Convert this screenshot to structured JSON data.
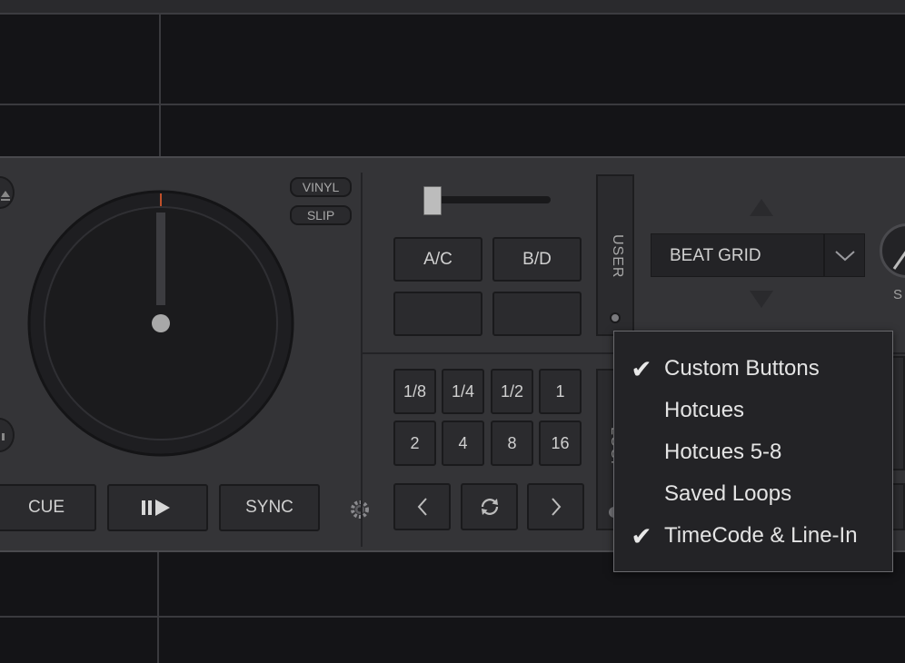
{
  "deck": {
    "vinyl_label": "VINYL",
    "slip_label": "SLIP",
    "cue_label": "CUE",
    "play_pause_icon": "play-pause-icon",
    "sync_label": "SYNC",
    "user_label": "USER",
    "loop_label": "LOOP",
    "pad_ac_label": "A/C",
    "pad_bd_label": "B/D",
    "grid_select_value": "BEAT GRID",
    "knob_label": "S",
    "loop_sizes": [
      "1/8",
      "1/4",
      "1/2",
      "1",
      "2",
      "4",
      "8",
      "16"
    ]
  },
  "menu": {
    "items": [
      {
        "label": "Custom Buttons",
        "checked": true
      },
      {
        "label": "Hotcues",
        "checked": false
      },
      {
        "label": "Hotcues 5-8",
        "checked": false
      },
      {
        "label": "Saved Loops",
        "checked": false
      },
      {
        "label": "TimeCode & Line-In",
        "checked": true
      }
    ]
  },
  "colors": {
    "background": "#141417",
    "panel": "#343437",
    "button": "#2b2b2e",
    "accent_marker": "#c0502a"
  }
}
